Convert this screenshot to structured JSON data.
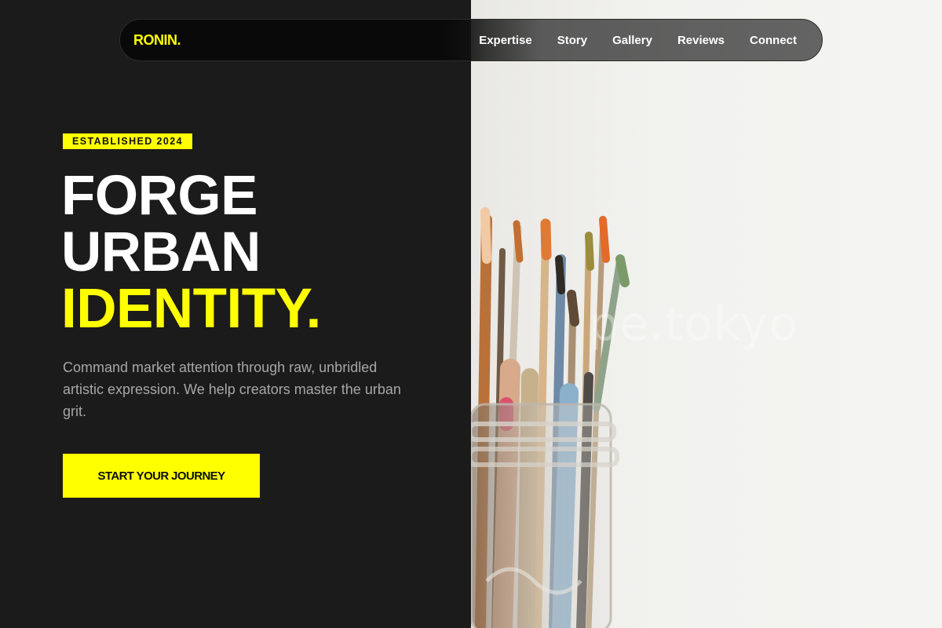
{
  "brand": {
    "logo": "RONIN."
  },
  "nav": {
    "links": [
      "Expertise",
      "Story",
      "Gallery",
      "Reviews",
      "Connect"
    ]
  },
  "hero": {
    "badge": "ESTABLISHED 2024",
    "title_line1": "FORGE",
    "title_line2": "URBAN",
    "title_line3": "IDENTITY.",
    "subtitle": "Command market attention through raw, unbridled artistic expression. We help creators master the urban grit.",
    "cta_label": "START YOUR JOURNEY"
  },
  "photo": {
    "watermark": "pe.tokyo"
  },
  "colors": {
    "accent": "#ffff00",
    "background": "#1b1b1b",
    "text_muted": "#a7a7a7"
  }
}
